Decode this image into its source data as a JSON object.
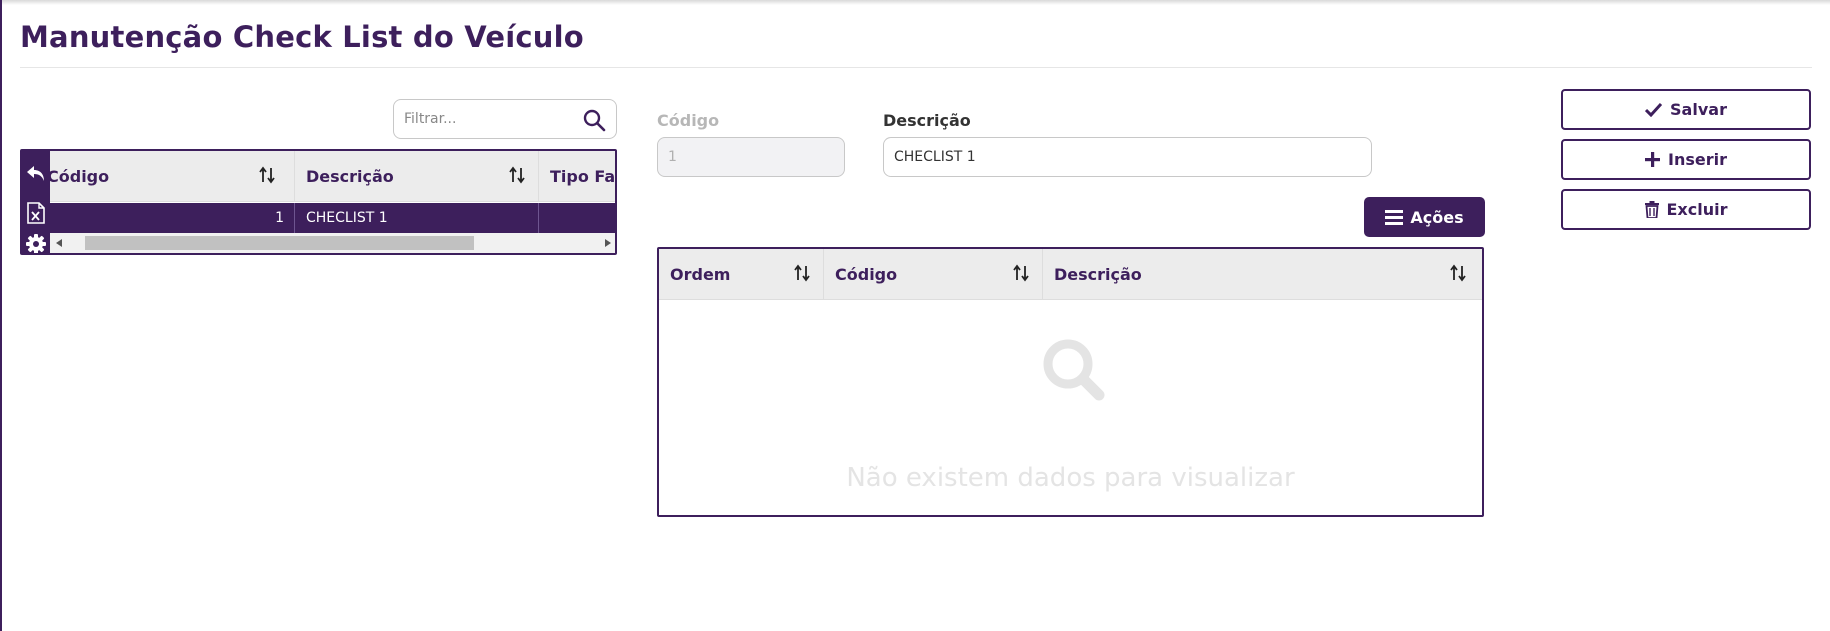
{
  "page": {
    "title": "Manutenção Check List do Veículo"
  },
  "filter": {
    "placeholder": "Filtrar..."
  },
  "list_grid": {
    "columns": [
      {
        "label": "Código"
      },
      {
        "label": "Descrição"
      },
      {
        "label": "Tipo Fam"
      }
    ],
    "rows": [
      {
        "codigo": "1",
        "descricao": "CHECLIST 1",
        "tipo": ""
      }
    ]
  },
  "form": {
    "codigo_label": "Código",
    "codigo_value": "1",
    "descricao_label": "Descrição",
    "descricao_value": "CHECLIST 1",
    "acoes_label": "Ações"
  },
  "items_grid": {
    "columns": [
      {
        "label": "Ordem"
      },
      {
        "label": "Código"
      },
      {
        "label": "Descrição"
      }
    ],
    "empty_message": "Não existem dados para visualizar"
  },
  "actions": {
    "save_label": "Salvar",
    "insert_label": "Inserir",
    "delete_label": "Excluir"
  },
  "colors": {
    "primary": "#3d1f5c",
    "header_bg": "#ececec",
    "disabled_bg": "#f2f2f4"
  }
}
